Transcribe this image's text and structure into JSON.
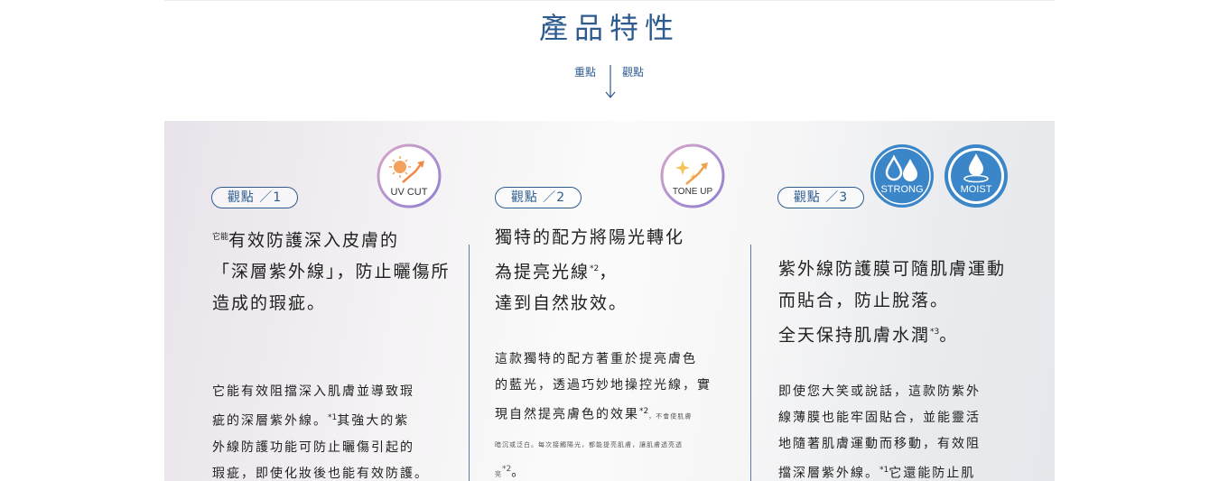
{
  "header": {
    "title": "產品特性",
    "focus_left": "重點",
    "focus_right": "觀點"
  },
  "features": [
    {
      "pill": "觀點 ／1",
      "badge": "UV CUT",
      "heading_prefix": "它能",
      "heading": [
        "有效防護深入皮膚的",
        "「深層紫外線」，防止曬傷所",
        "造成的瑕疵。"
      ],
      "body_lines": [
        "它能有效阻擋深入肌膚並導致瑕",
        "疵的深層紫外線。",
        "其強大的紫",
        "外線防護功能可防止曬傷引起的",
        "瑕疵，即使化妝後也能有效防護。"
      ],
      "note_ref": "*1"
    },
    {
      "pill": "觀點 ／2",
      "badge": "TONE UP",
      "heading": [
        "獨特的配方將陽光轉化",
        "為提亮光線",
        "，",
        "達到自然妝效。"
      ],
      "heading_note": "*2",
      "body_lines": [
        "這款獨特的配方著重於提亮膚色",
        "的藍光，透過巧妙地操控光線，實",
        "現自然提亮膚色的效果"
      ],
      "body_note": "*2",
      "fine_a": "，不會使肌膚",
      "fine_b": "暗沉或泛白。每次接觸陽光，都能提亮肌膚，讓肌膚透亮透",
      "fine_c": "亮",
      "fine_c_note": "*2",
      "fine_end": "。"
    },
    {
      "pill": "觀點 ／3",
      "badges": [
        "STRONG",
        "MOIST"
      ],
      "heading": [
        "紫外線防護膜可隨肌膚運動",
        "而貼合，防止脫落。",
        "全天保持肌膚水潤",
        "。"
      ],
      "heading_note": "*3",
      "body_lines": [
        "即使您大笑或說話，這款防紫外",
        "線薄膜也能牢固貼合，並能靈活",
        "地隨著肌膚運動而移動，有效阻",
        "擋深層紫外線。",
        "它還能防止肌"
      ],
      "note_ref": "*1"
    }
  ],
  "colors": {
    "brand_blue": "#2d5b8f",
    "badge_blue": "#3b86c8",
    "badge_ring": "#b6a6d6"
  }
}
